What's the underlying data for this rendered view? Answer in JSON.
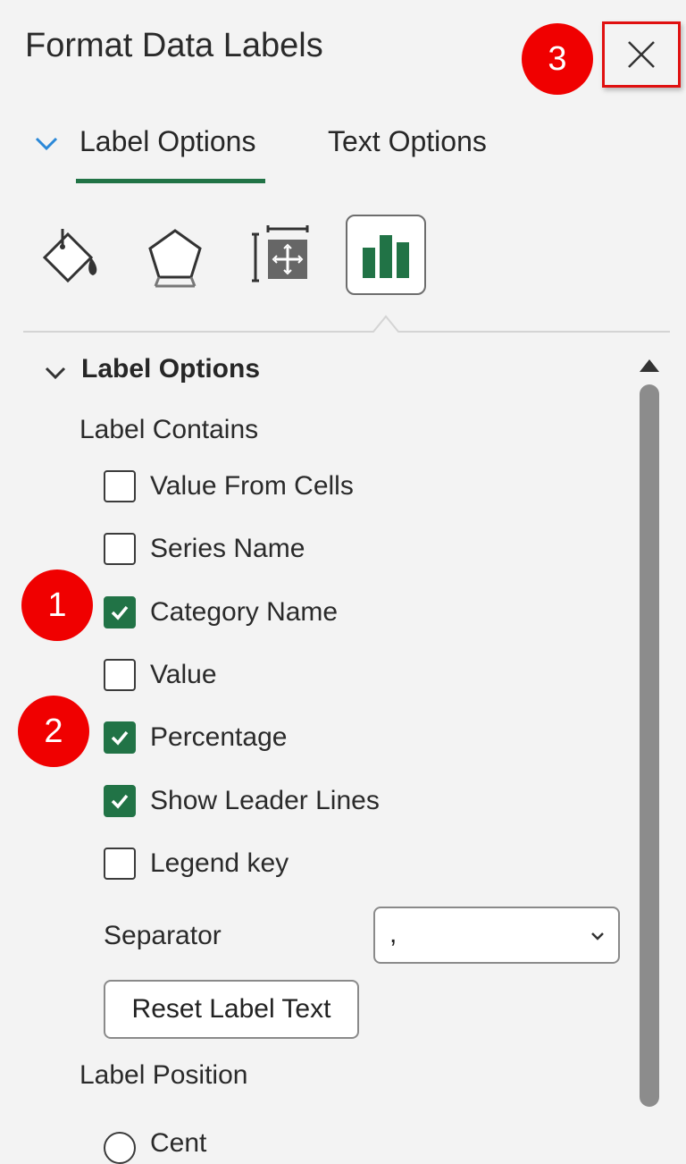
{
  "pane": {
    "title": "Format Data Labels"
  },
  "tabs": [
    {
      "label": "Label Options",
      "active": true
    },
    {
      "label": "Text Options",
      "active": false
    }
  ],
  "category_icons": [
    "fill-line-icon",
    "effects-icon",
    "size-properties-icon",
    "label-options-icon"
  ],
  "section": {
    "title": "Label Options",
    "label_contains": "Label Contains",
    "checkboxes": [
      {
        "label": "Value From Cells",
        "checked": false
      },
      {
        "label": "Series Name",
        "checked": false
      },
      {
        "label": "Category Name",
        "checked": true
      },
      {
        "label": "Value",
        "checked": false
      },
      {
        "label": "Percentage",
        "checked": true
      },
      {
        "label": "Show Leader Lines",
        "checked": true
      },
      {
        "label": "Legend key",
        "checked": false
      }
    ],
    "separator": {
      "label": "Separator",
      "value": ","
    },
    "reset_button": "Reset Label Text",
    "label_position": "Label Position",
    "partial_radio_label": "Cent"
  },
  "annotations": {
    "badge1": "1",
    "badge2": "2",
    "badge3": "3"
  },
  "colors": {
    "accent_green": "#217346",
    "annotation_red": "#f00000",
    "chevron_blue": "#2b88d8"
  }
}
